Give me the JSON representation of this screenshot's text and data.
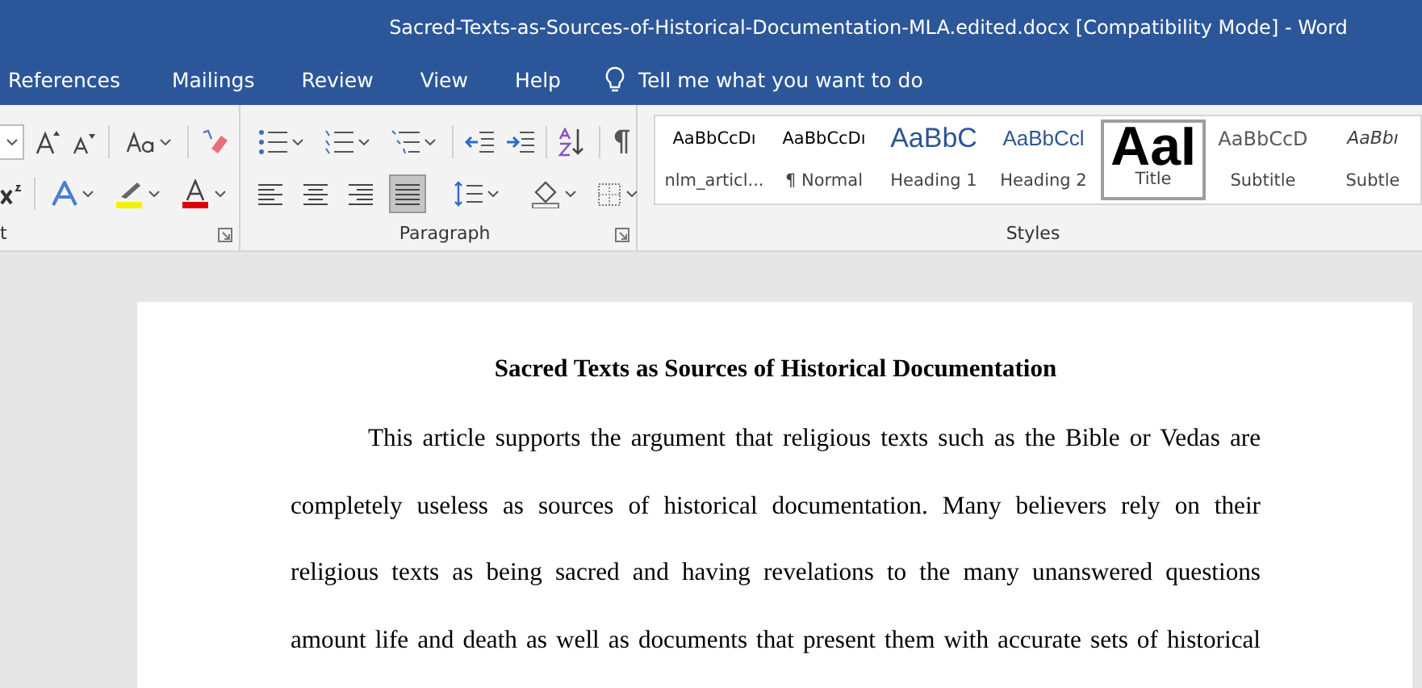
{
  "window": {
    "title": "Sacred-Texts-as-Sources-of-Historical-Documentation-MLA.edited.docx [Compatibility Mode]  -  Word"
  },
  "tabs": [
    "References",
    "Mailings",
    "Review",
    "View",
    "Help"
  ],
  "tell_me": {
    "placeholder": "Tell me what you want to do"
  },
  "font_group": {
    "label": "t"
  },
  "paragraph_group": {
    "label": "Paragraph",
    "align_buttons": [
      {
        "kind": "left",
        "selected": false
      },
      {
        "kind": "center",
        "selected": false
      },
      {
        "kind": "right",
        "selected": false
      },
      {
        "kind": "justify",
        "selected": true
      }
    ]
  },
  "styles_group": {
    "label": "Styles",
    "styles": [
      {
        "preview": "AaBbCcDı",
        "name": "nlm_articl...",
        "kind": "normal",
        "selected": false
      },
      {
        "preview": "AaBbCcDı",
        "name": "¶ Normal",
        "kind": "normal",
        "selected": false
      },
      {
        "preview": "AaBbC",
        "name": "Heading 1",
        "kind": "heading1",
        "selected": false
      },
      {
        "preview": "AaBbCcl",
        "name": "Heading 2",
        "kind": "heading2",
        "selected": false
      },
      {
        "preview": "AaI",
        "name": "Title",
        "kind": "title",
        "selected": true
      },
      {
        "preview": "AaBbCcD",
        "name": "Subtitle",
        "kind": "subtitle",
        "selected": false
      },
      {
        "preview": "AaBbı",
        "name": "Subtle",
        "kind": "subtle",
        "selected": false
      }
    ]
  },
  "document": {
    "heading": "Sacred Texts as Sources of Historical Documentation",
    "paragraph": "This article supports the argument that religious texts such as the Bible or Vedas are completely useless as sources of historical documentation. Many believers rely on their religious texts as being sacred and having revelations to the many unanswered questions amount life and death as well as documents that present them with accurate sets of historical"
  }
}
